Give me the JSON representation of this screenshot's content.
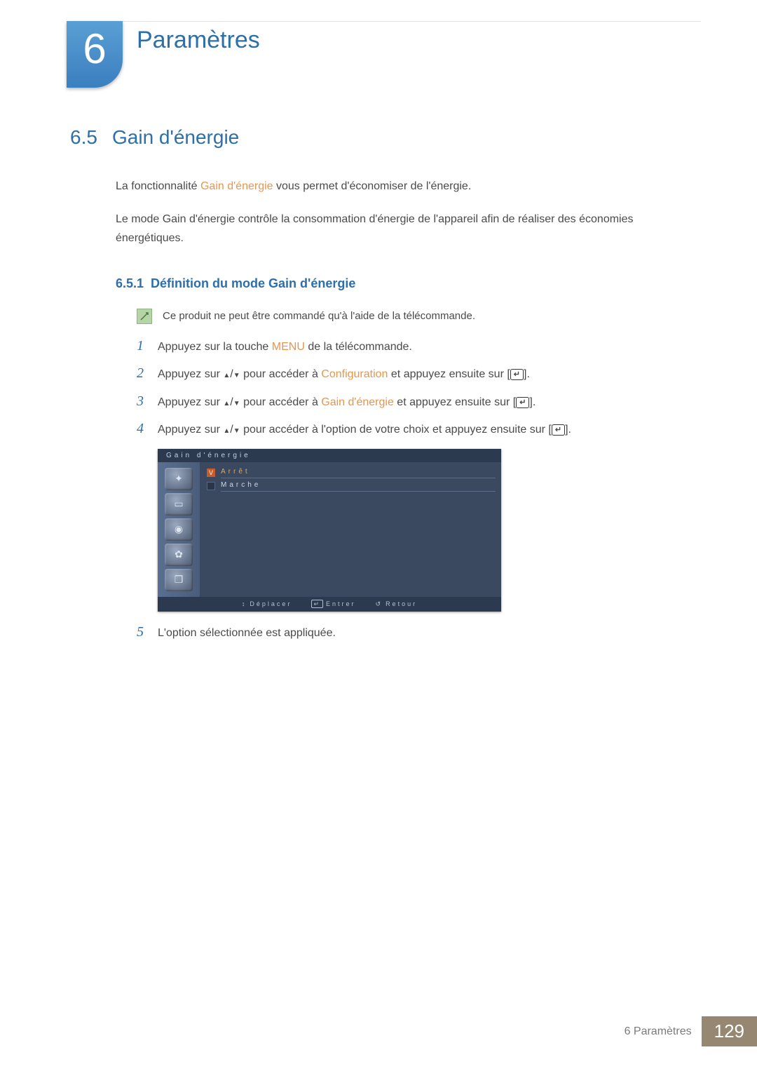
{
  "chapter": {
    "number": "6",
    "title": "Paramètres"
  },
  "section": {
    "number": "6.5",
    "title": "Gain d'énergie",
    "intro_pre": "La fonctionnalité ",
    "intro_highlight": "Gain d'énergie",
    "intro_post": " vous permet d'économiser de l'énergie.",
    "desc": "Le mode Gain d'énergie contrôle la consommation d'énergie de l'appareil afin de réaliser des économies énergétiques."
  },
  "subsection": {
    "number": "6.5.1",
    "title": "Définition du mode Gain d'énergie",
    "note": "Ce produit ne peut être commandé qu'à l'aide de la télécommande.",
    "steps": [
      {
        "num": "1",
        "pre": "Appuyez sur la touche ",
        "hl": "MENU",
        "post": " de la télécommande."
      },
      {
        "num": "2",
        "pre": "Appuyez sur ",
        "arrows": true,
        "mid": " pour accéder à ",
        "hl": "Configuration",
        "post": " et appuyez ensuite sur [",
        "enter": true,
        "end": "]."
      },
      {
        "num": "3",
        "pre": "Appuyez sur ",
        "arrows": true,
        "mid": " pour accéder à ",
        "hl": "Gain d'énergie",
        "post": " et appuyez ensuite sur [",
        "enter": true,
        "end": "]."
      },
      {
        "num": "4",
        "pre": "Appuyez sur ",
        "arrows": true,
        "mid": " pour accéder à l'option de votre choix et appuyez ensuite sur [",
        "hl": "",
        "post": "",
        "enter": true,
        "end": "]."
      },
      {
        "num": "5",
        "pre": "L'option sélectionnée est appliquée."
      }
    ]
  },
  "osd": {
    "title": "Gain d'énergie",
    "options": [
      {
        "label": "Arrêt",
        "selected": true
      },
      {
        "label": "Marche",
        "selected": false
      }
    ],
    "footer": {
      "move": "Déplacer",
      "enter": "Entrer",
      "return": "Retour"
    },
    "sidebar_icons": [
      "✦",
      "▭",
      "◉",
      "✿",
      "❐"
    ]
  },
  "footer": {
    "chapter_label": "6 Paramètres",
    "page": "129"
  }
}
